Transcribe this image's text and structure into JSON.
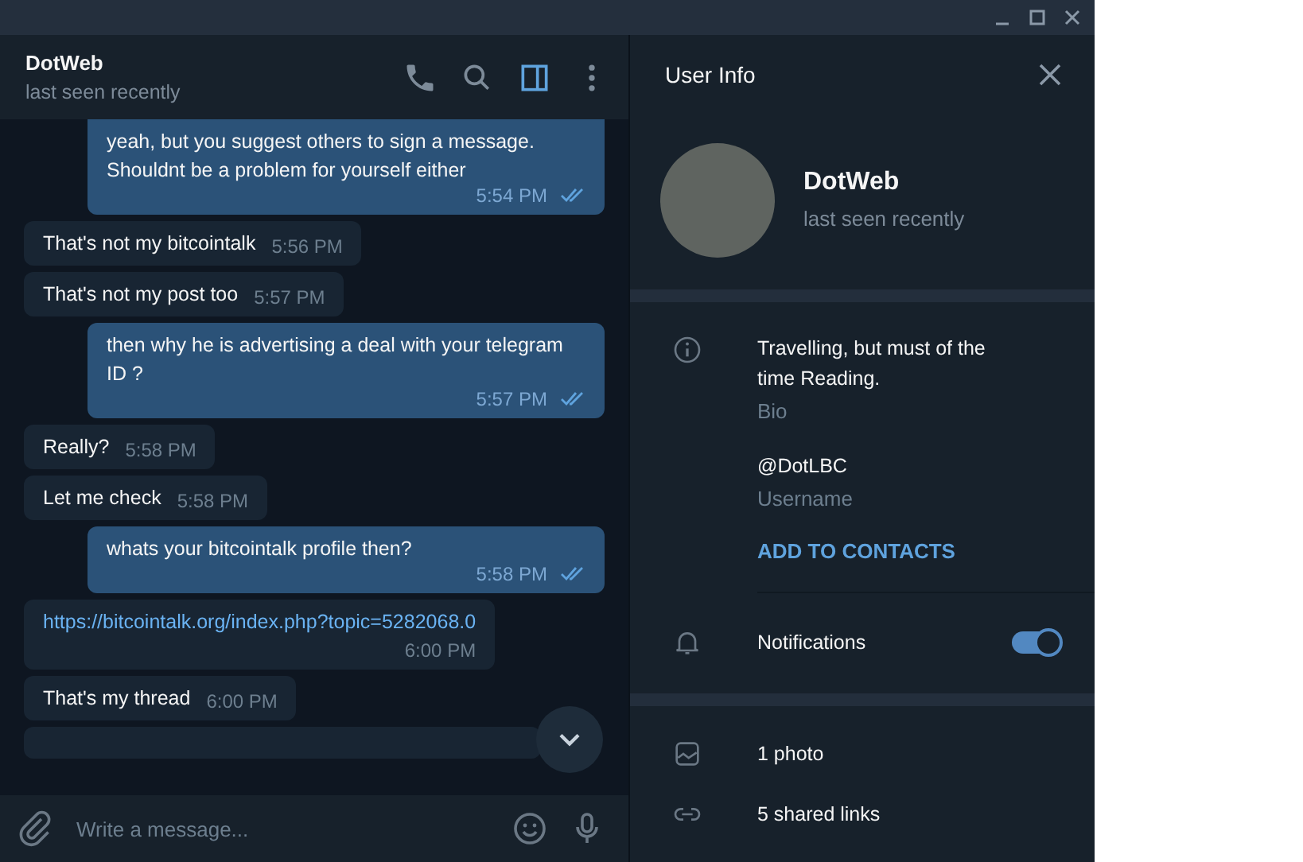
{
  "chat": {
    "title": "DotWeb",
    "status": "last seen recently"
  },
  "messages": [
    {
      "kind": "out",
      "text": "yeah, but you suggest others to sign a message. Shouldnt be a problem for yourself either",
      "time": "5:54 PM",
      "read": true
    },
    {
      "kind": "in",
      "text": "That's not my bitcointalk",
      "time": "5:56 PM"
    },
    {
      "kind": "in",
      "text": "That's not my post too",
      "time": "5:57 PM"
    },
    {
      "kind": "out",
      "text": "then why he is advertising a deal with your telegram ID ?",
      "time": "5:57 PM",
      "read": true
    },
    {
      "kind": "in",
      "text": "Really?",
      "time": "5:58 PM"
    },
    {
      "kind": "in",
      "text": "Let me check",
      "time": "5:58 PM"
    },
    {
      "kind": "out",
      "text": "whats your bitcointalk profile then?",
      "time": "5:58 PM",
      "read": true
    },
    {
      "kind": "link",
      "text": "https://bitcointalk.org/index.php?topic=5282068.0",
      "time": "6:00 PM"
    },
    {
      "kind": "in",
      "text": "That's my thread",
      "time": "6:00 PM"
    },
    {
      "kind": "cut"
    }
  ],
  "composer": {
    "placeholder": "Write a message..."
  },
  "panel": {
    "title": "User Info",
    "name": "DotWeb",
    "status": "last seen recently",
    "bio": "Travelling, but must of the time Reading.",
    "bio_label": "Bio",
    "username": "@DotLBC",
    "username_label": "Username",
    "add_contact": "ADD TO CONTACTS",
    "notifications": {
      "label": "Notifications",
      "on": true
    },
    "media": [
      {
        "kind": "photo",
        "label": "1 photo"
      },
      {
        "kind": "link",
        "label": "5 shared links"
      }
    ]
  }
}
